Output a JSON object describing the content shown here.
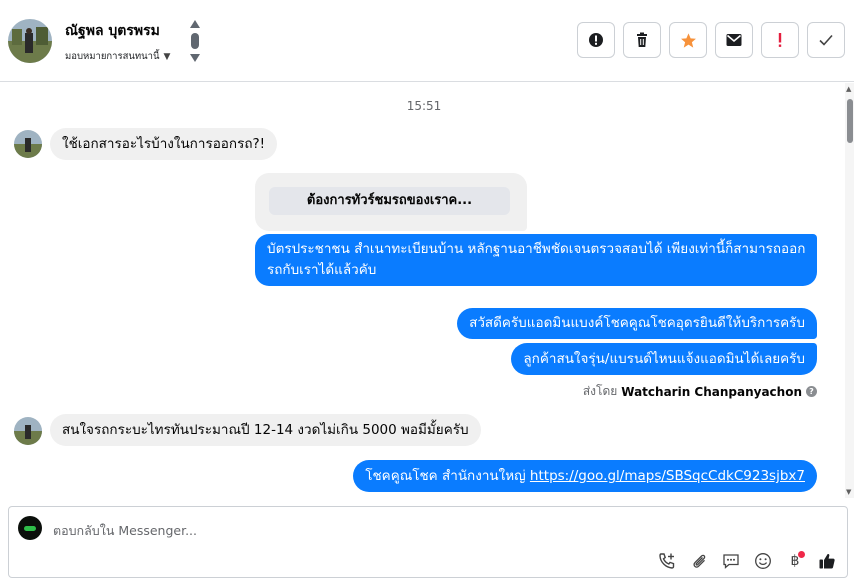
{
  "header": {
    "contact_name": "ณัฐพล บุตรพรม",
    "assign_label": "มอบหมายการสนทนานี้",
    "actions": [
      {
        "name": "mark-spam-button",
        "icon": "alert-circle-icon"
      },
      {
        "name": "delete-button",
        "icon": "trash-icon"
      },
      {
        "name": "star-button",
        "icon": "star-icon"
      },
      {
        "name": "mark-unread-button",
        "icon": "envelope-icon"
      },
      {
        "name": "mark-important-button",
        "icon": "exclamation-icon"
      },
      {
        "name": "mark-done-button",
        "icon": "check-icon"
      }
    ]
  },
  "thread": {
    "timestamp": "15:51",
    "messages": {
      "m1": "ใช้เอกสารอะไรบ้างในการออกรถ?!",
      "card_button": "ต้องการทัวร์ชมรถของเราค...",
      "m2_line1": "บัตรประชาชน สำเนาทะเบียนบ้าน หลักฐานอาชีพชัดเจนตรวจสอบได้ เพียงเท่านี้ก็สามารถออก",
      "m2_line2": "รถกับเราได้แล้วคับ",
      "m3": "สวัสดีครับแอดมินแบงค์โชคคูณโชคอุดรยินดีให้บริการครับ",
      "m4": "ลูกค้าสนใจรุ่น/แบรนด์ไหนแจ้งแอดมินได้เลยครับ",
      "m5": "สนใจรถกระบะไทรทันประมาณปี 12-14 งวดไม่เกิน 5000 พอมีมั้ยครับ",
      "m6_text": "โชคคูณโชค สำนักงานใหญ่ ",
      "m6_link": "https://goo.gl/maps/SBSqcCdkC923sjbx7"
    },
    "sent_by_prefix": "ส่งโดย",
    "sent_by_name": "Watcharin Chanpanyachon"
  },
  "composer": {
    "placeholder": "ตอบกลับใน Messenger...",
    "tools": [
      "phone-plus-icon",
      "paperclip-icon",
      "message-template-icon",
      "emoji-icon",
      "baht-payment-icon",
      "thumbs-up-icon"
    ]
  },
  "colors": {
    "outgoing_bubble": "#0a7cff",
    "incoming_bubble": "#f0f0f0",
    "star": "#f7923b",
    "important": "#e41e3f"
  }
}
